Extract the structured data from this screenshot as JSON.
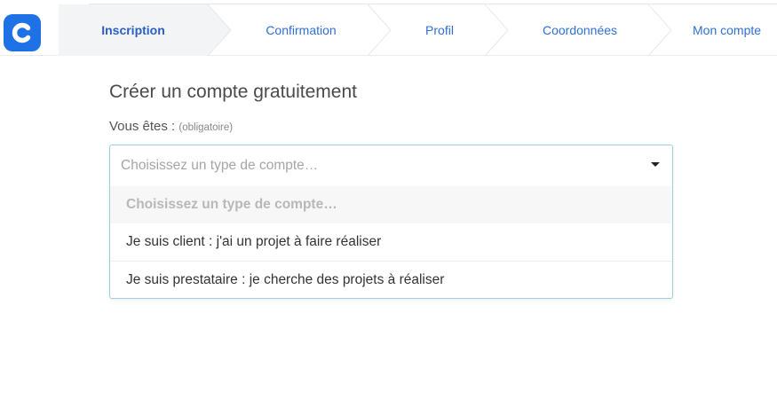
{
  "header": {
    "logo_letter": "C",
    "brand_color": "#1e72e6",
    "steps": [
      {
        "label": "Inscription",
        "active": true
      },
      {
        "label": "Confirmation",
        "active": false
      },
      {
        "label": "Profil",
        "active": false
      },
      {
        "label": "Coordonnées",
        "active": false
      },
      {
        "label": "Mon compte",
        "active": false
      }
    ]
  },
  "form": {
    "title": "Créer un compte gratuitement",
    "account_type_label": "Vous êtes :",
    "account_type_hint": "(obligatoire)",
    "select": {
      "current_value": "Choisissez un type de compte…",
      "options": [
        "Choisissez un type de compte…",
        "Je suis client : j'ai un projet à faire réaliser",
        "Je suis prestataire : je cherche des projets à réaliser"
      ]
    }
  }
}
